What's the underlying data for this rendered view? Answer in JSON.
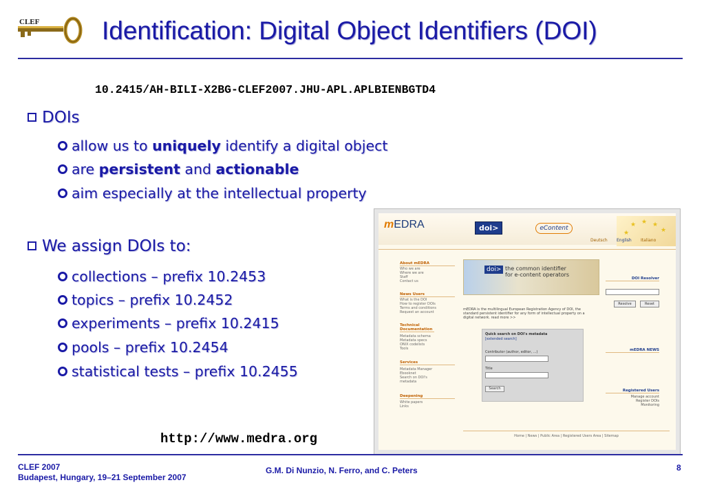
{
  "title": "Identification: Digital Object Identifiers (DOI)",
  "logo": {
    "text": "CLEF"
  },
  "doi_example": "10.2415/AH-BILI-X2BG-CLEF2007.JHU-APL.APLBIENBGTD4",
  "sections": [
    {
      "heading": "DOIs",
      "items": [
        {
          "parts": [
            "allow us to ",
            "uniquely",
            " identify a digital object"
          ]
        },
        {
          "parts": [
            "are ",
            "persistent",
            " and ",
            "actionable"
          ]
        },
        {
          "parts": [
            "aim especially at the intellectual property"
          ]
        }
      ]
    },
    {
      "heading": "We assign DOIs to:",
      "items": [
        {
          "text": "collections – prefix 10.2453"
        },
        {
          "text": "topics – prefix 10.2452"
        },
        {
          "text": "experiments – prefix 10.2415"
        },
        {
          "text": "pools – prefix 10.2454"
        },
        {
          "text": "statistical tests – prefix 10.2455"
        }
      ]
    }
  ],
  "url": "http://www.medra.org",
  "footer": {
    "left_line1": "CLEF 2007",
    "left_line2": "Budapest, Hungary, 19–21 September 2007",
    "center": "G.M. Di Nunzio, N. Ferro, and C. Peters",
    "page": "8"
  },
  "screenshot": {
    "logo_m": "m",
    "logo_rest": "EDRA",
    "doi_label": "doi>",
    "econtent": "eContent",
    "languages": [
      "Deutsch",
      "English",
      "Italiano"
    ],
    "sidebar": [
      {
        "heading": "About mEDRA",
        "links": [
          "Who we are",
          "Where we are",
          "Staff",
          "Contact us"
        ]
      },
      {
        "heading": "News Users",
        "links": [
          "What is the DOI",
          "How to register DOIs",
          "Terms and conditions",
          "Request an account"
        ]
      },
      {
        "heading": "Technical Documentation",
        "links": [
          "Metadata schema",
          "Metadata specs",
          "ONIX codelists",
          "Tools"
        ]
      },
      {
        "heading": "Services",
        "links": [
          "Metadata Manager",
          "Ebooknet",
          "Search on DOI's metadata"
        ]
      },
      {
        "heading": "Deepening",
        "links": [
          "White papers",
          "Links"
        ]
      }
    ],
    "banner": {
      "doi": "doi>",
      "line1": "the common identifier",
      "line2": "for e-content operators"
    },
    "intro": "mEDRA is the multilingual European Registration Agency of DOI, the standard persistent identifier for any form of intellectual property on a digital network.      read more >>",
    "search": {
      "title": "Quick search on DOI's metadata",
      "extended": "[extended search]",
      "contributor_label": "Contributor (author, editor, ...)",
      "title_label": "Title",
      "button": "Search"
    },
    "resolver": {
      "heading": "DOI Resolver",
      "resolve": "Resolve",
      "reset": "Reset"
    },
    "news_heading": "mEDRA NEWS",
    "registered": {
      "heading": "Registered Users",
      "links": [
        "Manage account",
        "Register DOIs",
        "Monitoring"
      ]
    },
    "footer": "Home | News | Public Area | Registered Users Area | Sitemap"
  }
}
